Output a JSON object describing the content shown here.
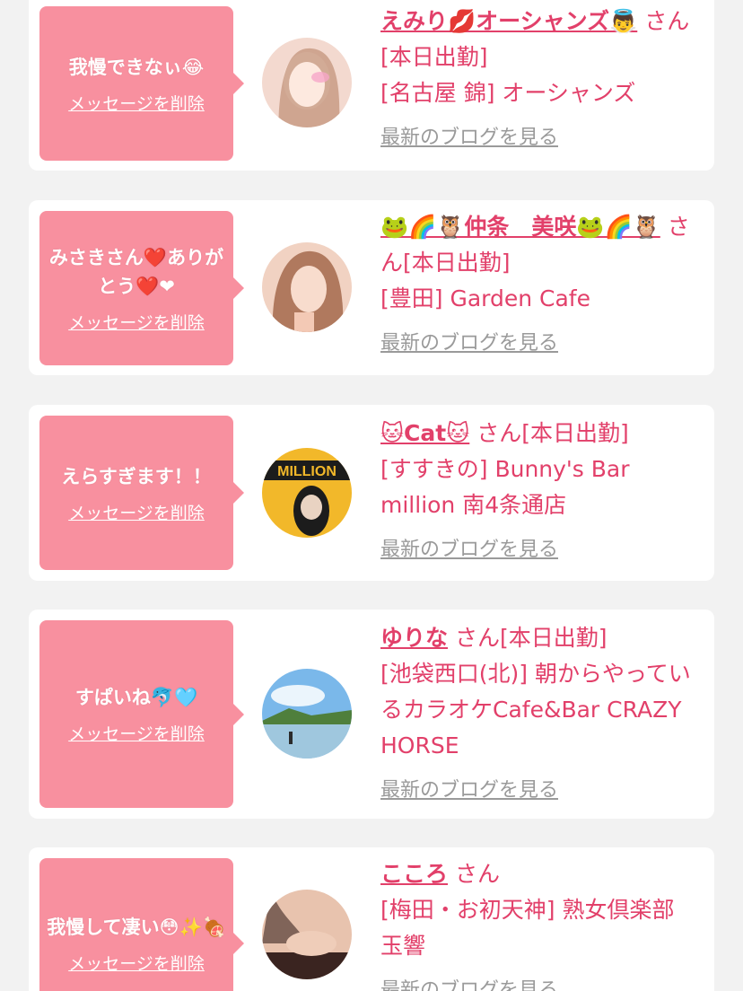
{
  "cards": [
    {
      "message": "我慢できなぃ😂",
      "delete_label": "メッセージを削除",
      "name": "えみり💋オーシャンズ👼",
      "suffix": "さん[本日出勤]",
      "location": "[名古屋 錦] オーシャンズ",
      "blog_label": "最新のブログを見る",
      "avatar_colors": [
        "#f3d9cf",
        "#b07a5c"
      ]
    },
    {
      "message": "みさきさん❤️ありがとう❤️❤",
      "delete_label": "メッセージを削除",
      "name": "🐸🌈🦉仲条　美咲🐸🌈🦉",
      "suffix": "さん[本日出勤]",
      "location": "[豊田] Garden Cafe",
      "blog_label": "最新のブログを見る",
      "avatar_colors": [
        "#f1d2c2",
        "#9a5b3c"
      ]
    },
    {
      "message": "えらすぎます！！",
      "delete_label": "メッセージを削除",
      "name": "🐱Cat🐱",
      "suffix": "さん[本日出勤]",
      "location": "[すすきの] Bunny's Bar million 南4条通店",
      "blog_label": "最新のブログを見る",
      "avatar_colors": [
        "#f2b82a",
        "#1c1c1c"
      ]
    },
    {
      "message": "すぱいね🐬🩵",
      "delete_label": "メッセージを削除",
      "name": "ゆりな",
      "suffix": "さん[本日出勤]",
      "location": "[池袋西口(北)] 朝からやっているカラオケCafe&Bar CRAZY HORSE",
      "blog_label": "最新のブログを見る",
      "avatar_colors": [
        "#7ab8ea",
        "#4f7f3c"
      ]
    },
    {
      "message": "我慢して凄い😳✨🍖",
      "delete_label": "メッセージを削除",
      "name": "こころ",
      "suffix": "さん",
      "location": "[梅田・お初天神] 熟女倶楽部 玉響",
      "blog_label": "最新のブログを見る",
      "avatar_colors": [
        "#e8c3ae",
        "#3a2420"
      ]
    }
  ]
}
